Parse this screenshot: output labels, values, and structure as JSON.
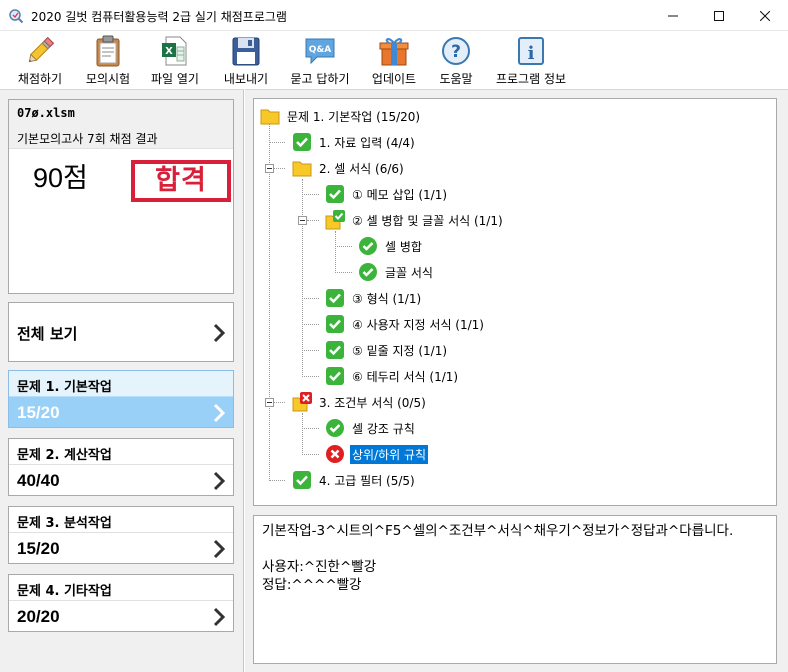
{
  "window": {
    "title": "2020 길벗 컴퓨터활용능력 2급 실기 채점프로그램"
  },
  "toolbar": {
    "grade": "채점하기",
    "mock": "모의시험",
    "open": "파일 열기",
    "export": "내보내기",
    "qna": "묻고 답하기",
    "update": "업데이트",
    "help": "도움말",
    "info": "프로그램 정보",
    "qna_icon_text": "Q&A"
  },
  "result": {
    "file": "07ø.xlsm",
    "subtitle": "기본모의고사 7회 채점 결과",
    "score": "90점",
    "stamp": "합격"
  },
  "nav": {
    "all": "전체 보기",
    "q1": {
      "title": "문제 1. 기본작업",
      "score": "15/20"
    },
    "q2": {
      "title": "문제 2. 계산작업",
      "score": "40/40"
    },
    "q3": {
      "title": "문제 3. 분석작업",
      "score": "15/20"
    },
    "q4": {
      "title": "문제 4. 기타작업",
      "score": "20/20"
    }
  },
  "tree": {
    "root": "문제 1. 기본작업 (15/20)",
    "n1": "1. 자료 입력 (4/4)",
    "n2": "2. 셀 서식 (6/6)",
    "n2_1": "① 메모 삽입 (1/1)",
    "n2_2": "② 셀 병합 및 글꼴 서식 (1/1)",
    "n2_2a": "셀 병합",
    "n2_2b": "글꼴 서식",
    "n2_3": "③ 형식 (1/1)",
    "n2_4": "④ 사용자 지정 서식 (1/1)",
    "n2_5": "⑤ 밑줄 지정 (1/1)",
    "n2_6": "⑥ 테두리 서식 (1/1)",
    "n3": "3. 조건부 서식 (0/5)",
    "n3_1": "셀 강조 규칙",
    "n3_2": "상위/하위 규칙",
    "n4": "4. 고급 필터 (5/5)"
  },
  "detail": {
    "text": "기본작업-3^시트의^F5^셀의^조건부^서식^채우기^정보가^정답과^다릅니다.\n\n사용자:^진한^빨강\n정답:^^^^빨강"
  },
  "colors": {
    "check_green": "#3cb43c",
    "error_red": "#e02020",
    "selected_blue": "#0078d7",
    "active_nav": "#99d0f7",
    "stamp_red": "#d8203a"
  }
}
